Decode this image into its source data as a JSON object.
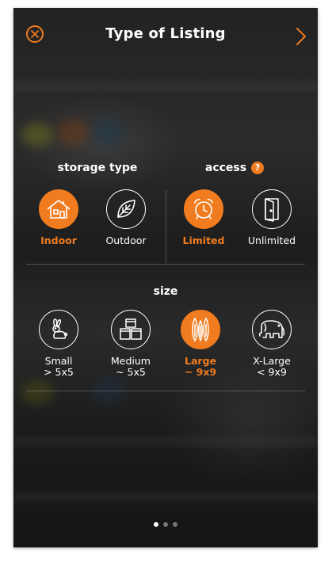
{
  "colors": {
    "accent": "#f07c1f",
    "text": "#ffffff"
  },
  "header": {
    "title": "Type of Listing",
    "close_icon": "close-circle-icon",
    "next_icon": "chevron-right-icon"
  },
  "storage": {
    "title": "storage type",
    "options": [
      {
        "label": "Indoor",
        "icon": "house-icon",
        "selected": true
      },
      {
        "label": "Outdoor",
        "icon": "leaf-icon",
        "selected": false
      }
    ]
  },
  "access": {
    "title": "access",
    "help": "?",
    "options": [
      {
        "label": "Limited",
        "icon": "alarm-clock-icon",
        "selected": true
      },
      {
        "label": "Unlimited",
        "icon": "open-door-icon",
        "selected": false
      }
    ]
  },
  "size": {
    "title": "size",
    "options": [
      {
        "label": "Small",
        "sub": "> 5x5",
        "icon": "rabbit-icon",
        "selected": false
      },
      {
        "label": "Medium",
        "sub": "~ 5x5",
        "icon": "boxes-icon",
        "selected": false
      },
      {
        "label": "Large",
        "sub": "~ 9x9",
        "icon": "surfboards-icon",
        "selected": true
      },
      {
        "label": "X-Large",
        "sub": "< 9x9",
        "icon": "elephant-icon",
        "selected": false
      }
    ]
  },
  "pagination": {
    "pages": 3,
    "current": 1
  }
}
